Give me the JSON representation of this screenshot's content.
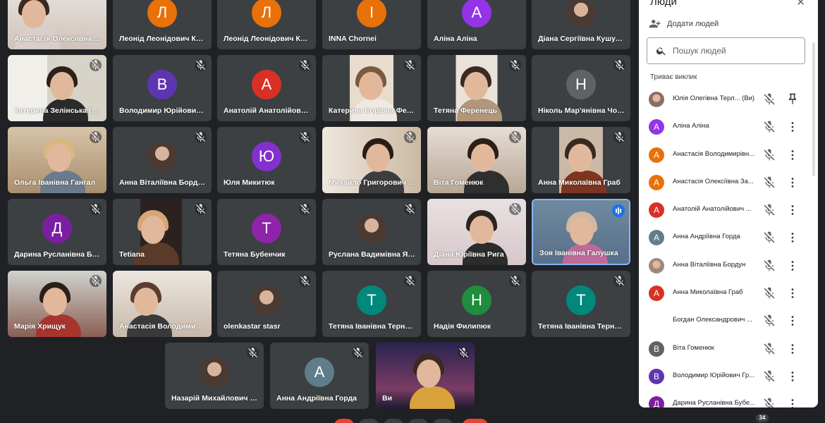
{
  "colors": {
    "background": "#202124",
    "tile": "#3c4043",
    "accent": "#1a73e8",
    "muted_icon": "#5f6368"
  },
  "tiles": [
    {
      "name": "Анастасія Олексіївна ...",
      "kind": "video",
      "mic": "none"
    },
    {
      "name": "Леонід Леонідович Кле...",
      "kind": "avatar",
      "letter": "Л",
      "color": "#e8710a",
      "mic": "none"
    },
    {
      "name": "Леонід Леонідович Кле...",
      "kind": "avatar",
      "letter": "Л",
      "color": "#e8710a",
      "mic": "none"
    },
    {
      "name": "INNA Chornei",
      "kind": "avatar",
      "letter": "I",
      "color": "#e8710a",
      "mic": "none"
    },
    {
      "name": "Аліна Аліна",
      "kind": "avatar",
      "letter": "А",
      "color": "#9334e6",
      "mic": "none"
    },
    {
      "name": "Діана Сергіївна Кушурб...",
      "kind": "photo-avatar",
      "mic": "none"
    },
    {
      "name": "Катерина Зелінська (С...",
      "kind": "video",
      "mic": "muted"
    },
    {
      "name": "Володимир Юрійович Г...",
      "kind": "avatar",
      "letter": "В",
      "color": "#5e35b1",
      "mic": "muted"
    },
    {
      "name": "Анатолій Анатолійович ...",
      "kind": "avatar",
      "letter": "А",
      "color": "#d93025",
      "mic": "muted"
    },
    {
      "name": "Катерина Ігорівна Фер...",
      "kind": "video",
      "mic": "muted"
    },
    {
      "name": "Тетяна Ференець",
      "kind": "video",
      "mic": "muted"
    },
    {
      "name": "Ніколь Мар'янівна Чорн...",
      "kind": "avatar",
      "letter": "Н",
      "color": "#5f6368",
      "mic": "muted"
    },
    {
      "name": "Ольга Іванівна Гангал",
      "kind": "video",
      "mic": "muted"
    },
    {
      "name": "Анна Віталіївна Бордун",
      "kind": "photo-avatar",
      "mic": "muted"
    },
    {
      "name": "Юля Микитюк",
      "kind": "avatar",
      "letter": "Ю",
      "color": "#8430ce",
      "mic": "muted"
    },
    {
      "name": "Михайло Григорович ...",
      "kind": "video",
      "mic": "muted"
    },
    {
      "name": "Віта Гоменюк",
      "kind": "video",
      "mic": "muted"
    },
    {
      "name": "Анна Миколаївна Граб",
      "kind": "video",
      "mic": "muted"
    },
    {
      "name": "Дарина Русланівна Буб...",
      "kind": "avatar",
      "letter": "Д",
      "color": "#7b1fa2",
      "mic": "muted"
    },
    {
      "name": "Tetiana",
      "kind": "video",
      "mic": "muted"
    },
    {
      "name": "Тетяна Бубенчик",
      "kind": "avatar",
      "letter": "Т",
      "color": "#8e24aa",
      "mic": "muted"
    },
    {
      "name": "Руслана Вадимівна Яки...",
      "kind": "photo-avatar",
      "mic": "muted"
    },
    {
      "name": "Діана Юріївна Рига",
      "kind": "video",
      "mic": "muted"
    },
    {
      "name": "Зоя Іванівна Галушка",
      "kind": "video",
      "mic": "speaking"
    },
    {
      "name": "Марія Хрищук",
      "kind": "video",
      "mic": "muted"
    },
    {
      "name": "Анастасія Володимирі...",
      "kind": "video",
      "mic": "none"
    },
    {
      "name": "olenkastar stasr",
      "kind": "photo-avatar",
      "mic": "muted"
    },
    {
      "name": "Тетяна Іванівна Тернове...",
      "kind": "avatar",
      "letter": "Т",
      "color": "#00897b",
      "mic": "muted"
    },
    {
      "name": "Надія Филипюк",
      "kind": "avatar",
      "letter": "Н",
      "color": "#1e8e3e",
      "mic": "muted"
    },
    {
      "name": "Тетяна Іванівна Тернове...",
      "kind": "avatar",
      "letter": "Т",
      "color": "#00897b",
      "mic": "muted"
    },
    {
      "name": "Назарій Михайлович Хр...",
      "kind": "photo-avatar",
      "mic": "muted"
    },
    {
      "name": "Анна Андріївна Горда",
      "kind": "avatar",
      "letter": "А",
      "color": "#607d8b",
      "mic": "muted"
    },
    {
      "name": "Ви",
      "kind": "video",
      "mic": "muted"
    }
  ],
  "panel": {
    "title": "Люди",
    "add_people": "Додати людей",
    "search_placeholder": "Пошук людей",
    "section": "Триває виклик",
    "participants": [
      {
        "name": "Юлія Олегівна Терл...",
        "suffix": "(Ви)",
        "letter": "",
        "color": "#8d6e63",
        "photo": true,
        "action": "pin"
      },
      {
        "name": "Аліна Аліна",
        "letter": "А",
        "color": "#9334e6",
        "action": "more"
      },
      {
        "name": "Анастасія Володимирівн...",
        "letter": "А",
        "color": "#e8710a",
        "action": "more"
      },
      {
        "name": "Анастасія Олексіївна За...",
        "letter": "А",
        "color": "#e8710a",
        "action": "more"
      },
      {
        "name": "Анатолій Анатолійович ...",
        "letter": "А",
        "color": "#d93025",
        "action": "more"
      },
      {
        "name": "Анна Андріївна Горда",
        "letter": "А",
        "color": "#607d8b",
        "action": "more"
      },
      {
        "name": "Анна Віталіївна Бордун",
        "letter": "",
        "color": "#a1887f",
        "photo": true,
        "action": "more"
      },
      {
        "name": "Анна Миколаївна Граб",
        "letter": "А",
        "color": "#d93025",
        "action": "more"
      },
      {
        "name": "Богдан Олександрович ...",
        "letter": "",
        "color": "#ffffff",
        "action": "more"
      },
      {
        "name": "Віта Гоменюк",
        "letter": "В",
        "color": "#5f6368",
        "action": "more"
      },
      {
        "name": "Володимир Юрійович Гр...",
        "letter": "В",
        "color": "#5e35b1",
        "action": "more"
      },
      {
        "name": "Дарина Русланівна Бубе...",
        "letter": "Д",
        "color": "#7b1fa2",
        "action": "more"
      }
    ]
  },
  "participant_count": "34"
}
